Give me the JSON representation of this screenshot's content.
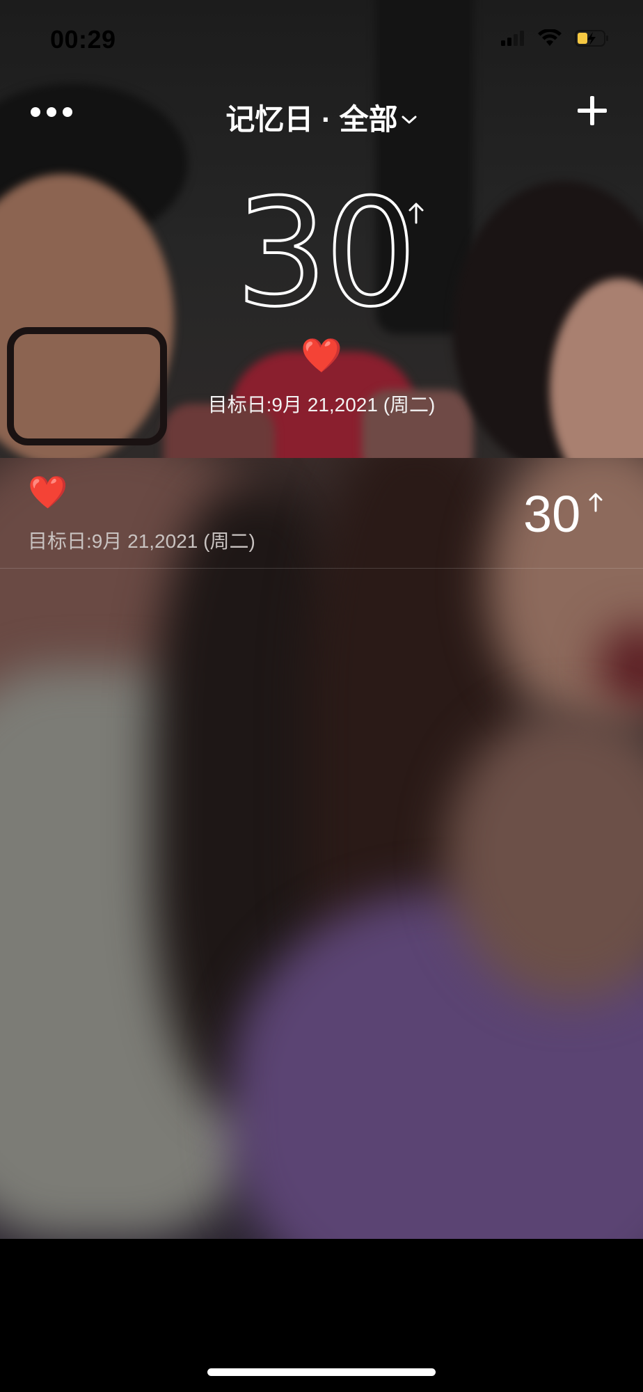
{
  "status_bar": {
    "time": "00:29"
  },
  "nav": {
    "title": "记忆日 · 全部",
    "more_icon": "ellipsis-icon",
    "dropdown_icon": "chevron-down-icon",
    "add_icon": "plus-icon"
  },
  "hero": {
    "count": "30",
    "direction_icon": "arrow-up-icon",
    "emoji": "❤️",
    "target_date": "目标日:9月 21,2021 (周二)"
  },
  "events": [
    {
      "emoji": "❤️",
      "target_date": "目标日:9月 21,2021 (周二)",
      "count": "30",
      "direction_icon": "arrow-up-icon"
    }
  ],
  "colors": {
    "text_primary": "#ffffff",
    "text_secondary": "#c9c3c1",
    "battery_charging": "#f5c842",
    "background": "#000000"
  }
}
